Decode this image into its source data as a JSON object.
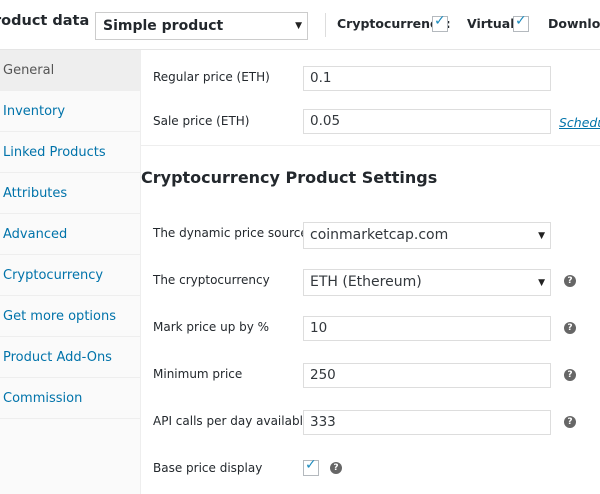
{
  "header": {
    "title": "roduct data —",
    "product_type": "Simple product",
    "dropdown_arrow": "▼",
    "options": [
      {
        "label": "Cryptocurrency:",
        "checked": true
      },
      {
        "label": "Virtual:",
        "checked": true
      },
      {
        "label": "Download",
        "checked": false
      }
    ],
    "check_glyph": "✓"
  },
  "tabs": [
    {
      "label": "General",
      "active": true
    },
    {
      "label": "Inventory",
      "active": false
    },
    {
      "label": "Linked Products",
      "active": false
    },
    {
      "label": "Attributes",
      "active": false
    },
    {
      "label": "Advanced",
      "active": false
    },
    {
      "label": "Cryptocurrency",
      "active": false
    },
    {
      "label": "Get more options",
      "active": false
    },
    {
      "label": "Product Add-Ons",
      "active": false
    },
    {
      "label": "Commission",
      "active": false
    }
  ],
  "pricing": {
    "regular_price_label": "Regular price (ETH)",
    "regular_price_value": "0.1",
    "sale_price_label": "Sale price (ETH)",
    "sale_price_value": "0.05",
    "schedule_link": "Schedu"
  },
  "crypto_settings": {
    "title": "Cryptocurrency Product Settings",
    "help_glyph": "?",
    "dynamic_price_source": {
      "label": "The dynamic price source",
      "value": "coinmarketcap.com"
    },
    "cryptocurrency": {
      "label": "The cryptocurrency",
      "value": "ETH (Ethereum)"
    },
    "mark_up": {
      "label": "Mark price up by %",
      "value": "10"
    },
    "minimum_price": {
      "label": "Minimum price",
      "value": "250"
    },
    "api_calls": {
      "label": "API calls per day available",
      "value": "333"
    },
    "base_price_display": {
      "label": "Base price display",
      "checked": true
    }
  },
  "colors": {
    "link": "#0073aa",
    "checkmark": "#1e8cbe",
    "active_tab_bg": "#eeeeee",
    "help_icon_bg": "#666666"
  }
}
